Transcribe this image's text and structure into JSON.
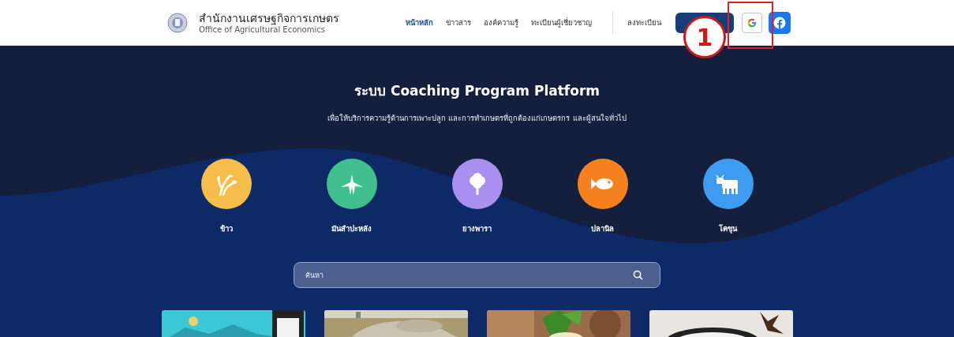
{
  "header": {
    "title": "สำนักงานเศรษฐกิจการเกษตร",
    "subtitle": "Office of Agricultural Economics",
    "nav": [
      {
        "label": "หน้าหลัก",
        "selected": true
      },
      {
        "label": "ข่าวสาร",
        "selected": false
      },
      {
        "label": "องค์ความรู้",
        "selected": false
      },
      {
        "label": "ทะเบียนผู้เชี่ยวชาญ",
        "selected": false
      }
    ],
    "register": "ลงทะเบียน",
    "callout": "1"
  },
  "hero": {
    "title": "ระบบ Coaching Program Platform",
    "subtitle": "เพื่อให้บริการความรู้ด้านการเพาะปลูก และการทำเกษตรที่ถูกต้องแก่เกษตรกร และผู้สนใจทั่วไป",
    "categories": [
      {
        "label": "ข้าว",
        "color": "#f6bd4a"
      },
      {
        "label": "มันสำปะหลัง",
        "color": "#3fc08c"
      },
      {
        "label": "ยางพารา",
        "color": "#a98ff0"
      },
      {
        "label": "ปลานิล",
        "color": "#f5821f"
      },
      {
        "label": "โคขุน",
        "color": "#3d9cf0"
      }
    ],
    "search": {
      "placeholder": "ค้นหา"
    }
  }
}
